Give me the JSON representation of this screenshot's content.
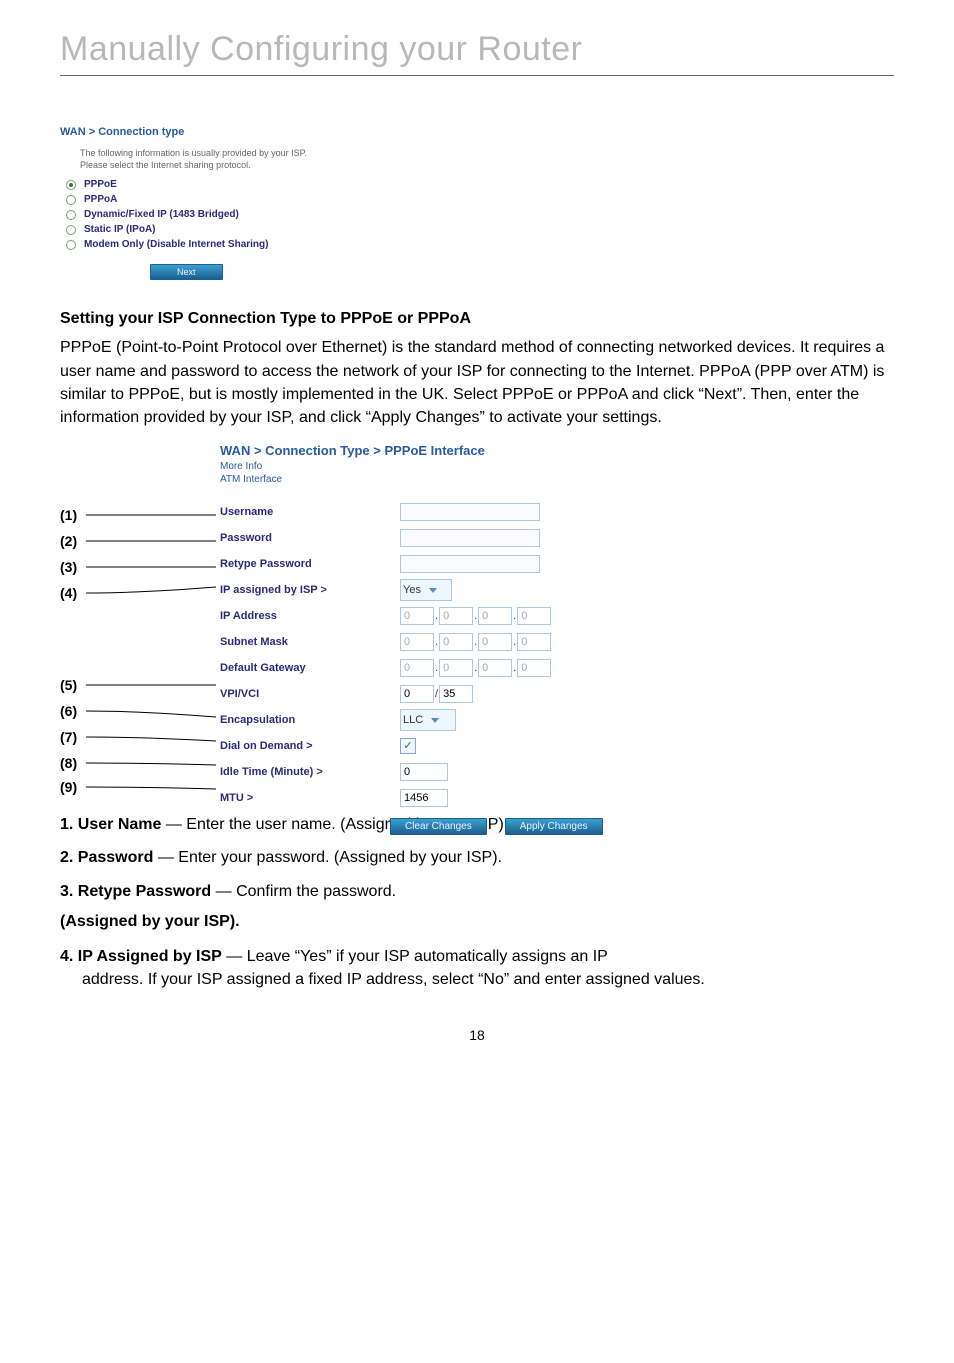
{
  "page_title": "Manually Configuring your Router",
  "page_number": "18",
  "shot1": {
    "breadcrumb": "WAN > Connection type",
    "instructions_l1": "The following information is usually provided by your ISP.",
    "instructions_l2": "Please select the Internet sharing protocol.",
    "opts": {
      "o1": "PPPoE",
      "o2": "PPPoA",
      "o3": "Dynamic/Fixed IP (1483 Bridged)",
      "o4": "Static IP (IPoA)",
      "o5": "Modem Only (Disable Internet Sharing)"
    },
    "next": "Next"
  },
  "section_heading": "Setting your ISP Connection Type to PPPoE or PPPoA",
  "section_para": "PPPoE (Point-to-Point Protocol over Ethernet) is the standard method of connecting networked devices. It requires a user name and password to access the network of your ISP for connecting to the Internet. PPPoA (PPP over ATM) is similar to PPPoE, but is mostly implemented in the UK. Select PPPoE or PPPoA and click “Next”. Then, enter the information provided by your ISP, and click “Apply Changes” to activate your settings.",
  "shot2": {
    "breadcrumb": "WAN > Connection Type > PPPoE Interface",
    "sub1": "More Info",
    "sub2": "ATM Interface",
    "labels": {
      "username": "Username",
      "password": "Password",
      "retype": "Retype Password",
      "ipassigned": "IP assigned by ISP >",
      "ipaddr": "IP Address",
      "subnet": "Subnet Mask",
      "gateway": "Default Gateway",
      "vpivci": "VPI/VCI",
      "encap": "Encapsulation",
      "dod": "Dial on Demand >",
      "idle": "Idle Time (Minute) >",
      "mtu": "MTU >"
    },
    "values": {
      "yes": "Yes",
      "ip0": "0",
      "vpi": "0",
      "vci": "35",
      "slash": "/",
      "llc": "LLC",
      "idle": "0",
      "mtu": "1456",
      "clear": "Clear Changes",
      "apply": "Apply Changes"
    }
  },
  "callouts": {
    "c1": "(1)",
    "c2": "(2)",
    "c3": "(3)",
    "c4": "(4)",
    "c5": "(5)",
    "c6": "(6)",
    "c7": "(7)",
    "c8": "(8)",
    "c9": "(9)"
  },
  "items": {
    "i1_b": "1. User Name",
    "i1_t": " —  Enter the user name. (Assigned by your ISP).",
    "i2_b": "2. Password",
    "i2_t": " —  Enter your password. (Assigned by your ISP).",
    "i3_b": "3. Retype Password",
    "i3_t": " —  Confirm the password.",
    "standalone": "(Assigned by your ISP).",
    "i4_b": "4. IP Assigned by ISP",
    "i4_t1": " —  Leave “Yes” if your ISP automatically assigns an IP",
    "i4_t2": "address. If your ISP assigned a fixed IP address, select “No” and enter assigned values."
  }
}
